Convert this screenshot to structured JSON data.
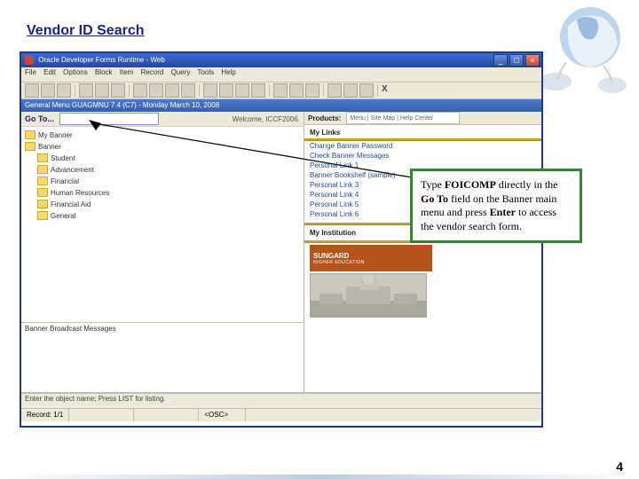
{
  "slide": {
    "title": "Vendor ID Search",
    "page_number": "4"
  },
  "window": {
    "title": "Oracle Developer Forms Runtime - Web",
    "menu": [
      "File",
      "Edit",
      "Options",
      "Block",
      "Item",
      "Record",
      "Query",
      "Tools",
      "Help"
    ],
    "context_bar": "General Menu GUAGMNU 7.4 (C7) - Monday March 10, 2008"
  },
  "goto": {
    "label": "Go To...",
    "welcome": "Welcome, ICCF2006."
  },
  "tree": {
    "top": [
      {
        "label": "My Banner"
      },
      {
        "label": "Banner"
      }
    ],
    "children": [
      {
        "label": "Student"
      },
      {
        "label": "Advancement"
      },
      {
        "label": "Financial"
      },
      {
        "label": "Human Resources"
      },
      {
        "label": "Financial Aid"
      },
      {
        "label": "General"
      }
    ]
  },
  "broadcast": {
    "label": "Banner Broadcast Messages"
  },
  "right": {
    "products_label": "Products:",
    "products_value": "Menu | Site Map | Help Center",
    "my_links": "My Links",
    "links": [
      "Change Banner Password",
      "Check Banner Messages",
      "Personal Link 1",
      "Banner Bookshelf (sample)",
      "Personal Link 3",
      "Personal Link 4",
      "Personal Link 5",
      "Personal Link 6"
    ],
    "my_institution": "My Institution",
    "sungard": "SUNGARD",
    "sungard_sub": "HIGHER EDUCATION"
  },
  "status": {
    "line1": "Enter the object name; Press LIST for listing.",
    "record": "Record: 1/1"
  },
  "callout": {
    "t1": "Type ",
    "b1": "FOICOMP",
    "t2": " directly in the ",
    "b2": "Go To",
    "t3": " field on the Banner main menu and press ",
    "b3": "Enter",
    "t4": " to access the vendor search form."
  }
}
